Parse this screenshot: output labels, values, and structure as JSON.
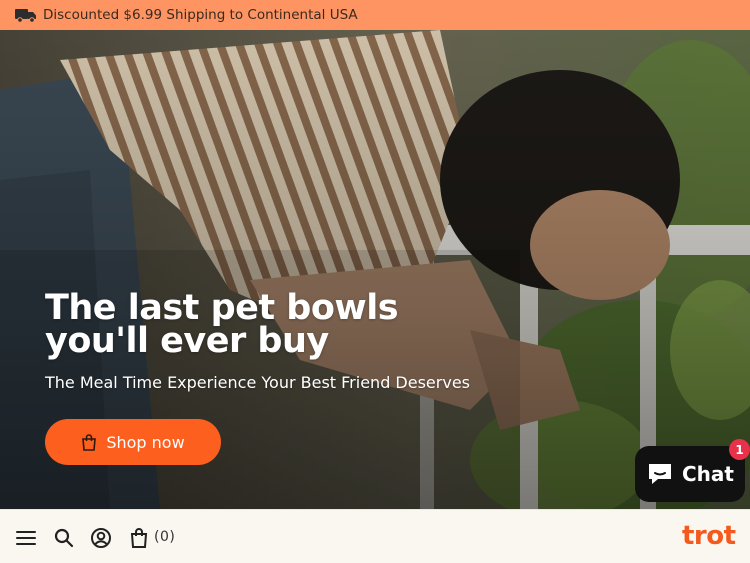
{
  "announcement": {
    "icon": "truck-icon",
    "text": "Discounted $6.99 Shipping to Continental USA"
  },
  "hero": {
    "title": "The last pet bowls you'll ever buy",
    "subtitle": "The Meal Time Experience Your Best Friend Deserves",
    "cta_label": "Shop now",
    "cta_icon": "shopping-bag-icon"
  },
  "chat": {
    "label": "Chat",
    "badge_count": "1",
    "icon": "chat-bubble-icon"
  },
  "bottom_nav": {
    "cart_count": "(0)",
    "logo": "trot",
    "icons": [
      "menu-icon",
      "search-icon",
      "account-icon",
      "cart-bag-icon"
    ]
  },
  "colors": {
    "announcement_bg": "#fd9462",
    "cta_bg": "#fd5f1e",
    "logo": "#f45a1e",
    "chat_bg": "#111111",
    "badge": "#e8324a",
    "bottom_bar_bg": "#faf6f0"
  }
}
